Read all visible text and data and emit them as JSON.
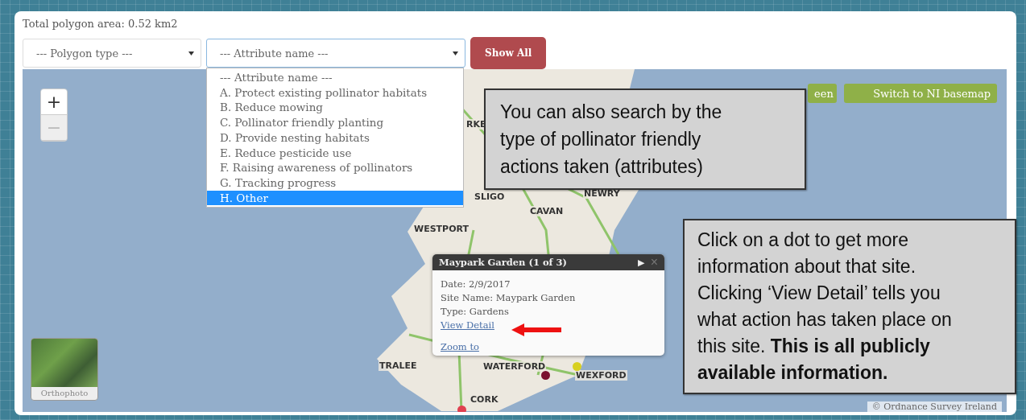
{
  "summary": "Total polygon area: 0.52 km2",
  "filters": {
    "polygon_type": {
      "placeholder": "--- Polygon type ---"
    },
    "attribute_name": {
      "placeholder": "--- Attribute name ---",
      "expanded": true,
      "options": [
        {
          "label": "--- Attribute name ---",
          "selected": false
        },
        {
          "label": "A. Protect existing pollinator habitats",
          "selected": false
        },
        {
          "label": "B. Reduce mowing",
          "selected": false
        },
        {
          "label": "C. Pollinator friendly planting",
          "selected": false
        },
        {
          "label": "D. Provide nesting habitats",
          "selected": false
        },
        {
          "label": "E. Reduce pesticide use",
          "selected": false
        },
        {
          "label": "F. Raising awareness of pollinators",
          "selected": false
        },
        {
          "label": "G. Tracking progress",
          "selected": false
        },
        {
          "label": "H. Other",
          "selected": true
        }
      ]
    },
    "show_all": "Show All"
  },
  "map": {
    "zoom_in": {
      "label": "+",
      "disabled": false
    },
    "zoom_out": {
      "label": "−",
      "disabled": true
    },
    "basemap_buttons": [
      "een",
      "Switch to NI basemap"
    ],
    "places": [
      "RKE",
      "SLIGO",
      "NEWRY",
      "CAVAN",
      "WESTPORT",
      "TRALEE",
      "WATERFORD",
      "WEXFORD",
      "CORK"
    ],
    "markers": [
      {
        "color": "#7a1030"
      },
      {
        "color": "#d8d020"
      },
      {
        "color": "#e04050"
      }
    ],
    "popup": {
      "title": "Maypark Garden (1 of 3)",
      "next": "▶",
      "close": "×",
      "lines": [
        "Date: 2/9/2017",
        "Site Name: Maypark Garden",
        "Type: Gardens"
      ],
      "links": [
        "View Detail",
        "Zoom to"
      ]
    },
    "layer_switcher": "Orthophoto",
    "attribution": "© Ordnance Survey Ireland"
  },
  "callouts": [
    "You can also search by the type of pollinator friendly actions taken (attributes)",
    "Click on a dot to get more information about that site. Clicking ‘View Detail’ tells you what action has taken place on this site. **This is all publicly available information.**"
  ]
}
